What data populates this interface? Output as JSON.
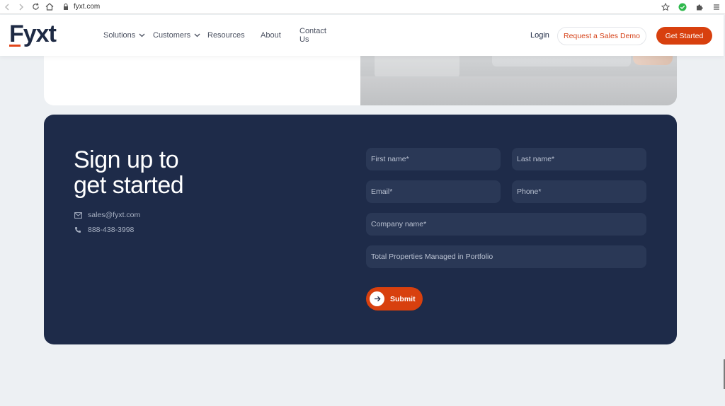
{
  "browser": {
    "url": "fyxt.com"
  },
  "header": {
    "logo": "Fyxt",
    "nav": {
      "solutions": "Solutions",
      "customers": "Customers",
      "resources": "Resources",
      "about": "About",
      "contact": "Contact Us"
    },
    "login": "Login",
    "demo_button": "Request a Sales Demo",
    "start_button": "Get Started"
  },
  "signup": {
    "title_line1": "Sign up to",
    "title_line2": "get started",
    "email": "sales@fyxt.com",
    "phone": "888-438-3998",
    "fields": {
      "first_name": "First name*",
      "last_name": "Last name*",
      "email": "Email*",
      "phone": "Phone*",
      "company": "Company name*",
      "properties": "Total Properties Managed in Portfolio"
    },
    "submit": "Submit"
  },
  "colors": {
    "brand_dark": "#1e2b49",
    "accent": "#d8400e",
    "field_bg": "#2a3856"
  }
}
